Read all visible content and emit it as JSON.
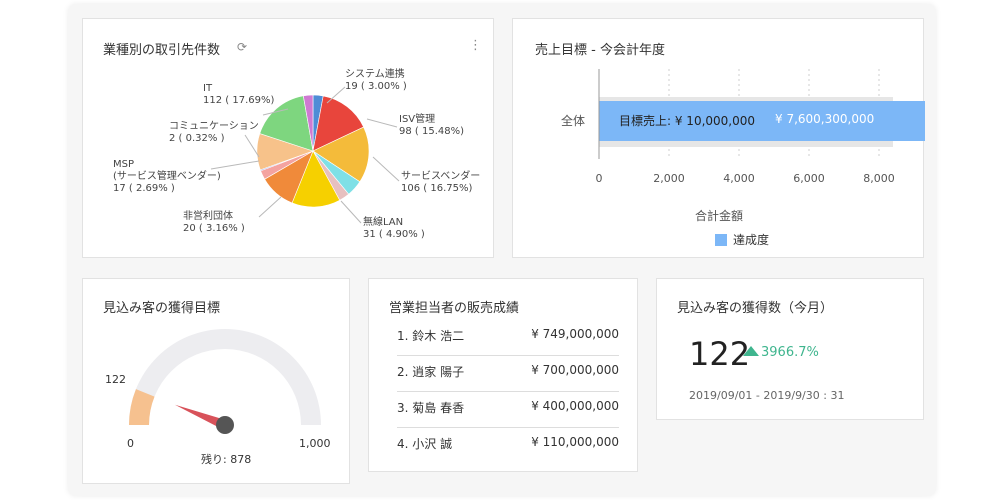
{
  "industry_card": {
    "title": "業種別の取引先件数",
    "refresh_icon": "refresh-icon",
    "menu_icon": "kebab-menu-icon"
  },
  "chart_data": [
    {
      "type": "pie",
      "labels": [
        "IT",
        "システム連携",
        "ISV管理",
        "サービスベンダー",
        "無線LAN",
        "非営利団体",
        "MSP\n(サービス管理ベンダー)",
        "コミュニケーション"
      ],
      "display_names": [
        "IT",
        "システム連携",
        "ISV管理",
        "サービスベンダー",
        "無線LAN",
        "非営利団体",
        "MSP",
        "(サービス管理ベンダー)",
        "コミュニケーション"
      ],
      "values": [
        112,
        19,
        98,
        106,
        31,
        20,
        17,
        2
      ],
      "value_text": [
        "112 ( 17.69%)",
        "19 ( 3.00% )",
        "98 ( 15.48%)",
        "106 ( 16.75%)",
        "31 ( 4.90% )",
        "20 ( 3.16% )",
        "17 ( 2.69% )",
        "2 ( 0.32% )"
      ],
      "colors": [
        "#7ed67f",
        "#4f8cd6",
        "#e8453c",
        "#f4bb3a",
        "#7fe0e6",
        "#e7c0bf",
        "#f4a3a0",
        "#8ea0f0"
      ],
      "filler_colors": [
        "#f6d000",
        "#f08a3a",
        "#f7c28a",
        "#cf7ad2",
        "#9bdc6a",
        "#f36f6f"
      ]
    },
    {
      "type": "bar",
      "title": "売上目標 - 今会計年度",
      "categories": [
        "全体"
      ],
      "series": [
        {
          "name": "達成度",
          "values": [
            7600.3
          ]
        }
      ],
      "bar_text": {
        "target": "目標売上: ¥ 10,000,000",
        "actual": "¥ 7,600,300,000"
      },
      "xlabel": "合計金額",
      "xticks": [
        "0",
        "2,000",
        "4,000",
        "6,000",
        "8,000"
      ],
      "xlim": [
        0,
        8000
      ],
      "target_value": 8000,
      "colors": {
        "bar": "#7cb7f7",
        "track": "#e6e6e6"
      }
    }
  ],
  "gauge_card": {
    "title": "見込み客の獲得目標",
    "value": 122,
    "value_label": "122",
    "min_label": "0",
    "max_label": "1,000",
    "remaining_label": "残り: 878",
    "max": 1000,
    "colors": {
      "fill": "#f6c18f",
      "track": "#ededf0",
      "needle": "#d8525a",
      "hub": "#555555"
    }
  },
  "sales_card": {
    "title": "営業担当者の販売成績",
    "rows": [
      {
        "name": "1. 鈴木 浩二",
        "amount": "¥ 749,000,000"
      },
      {
        "name": "2. 逍家 陽子",
        "amount": "¥ 700,000,000"
      },
      {
        "name": "3. 菊島 春香",
        "amount": "¥ 400,000,000"
      },
      {
        "name": "4. 小沢 誠",
        "amount": "¥ 110,000,000"
      }
    ]
  },
  "leads_card": {
    "title": "見込み客の獲得数（今月）",
    "value": "122",
    "change": "3966.7%",
    "date_range": "2019/09/01 - 2019/9/30 : 31",
    "colors": {
      "up": "#3fb58e"
    },
    "up_icon": "triangle-up-icon"
  }
}
